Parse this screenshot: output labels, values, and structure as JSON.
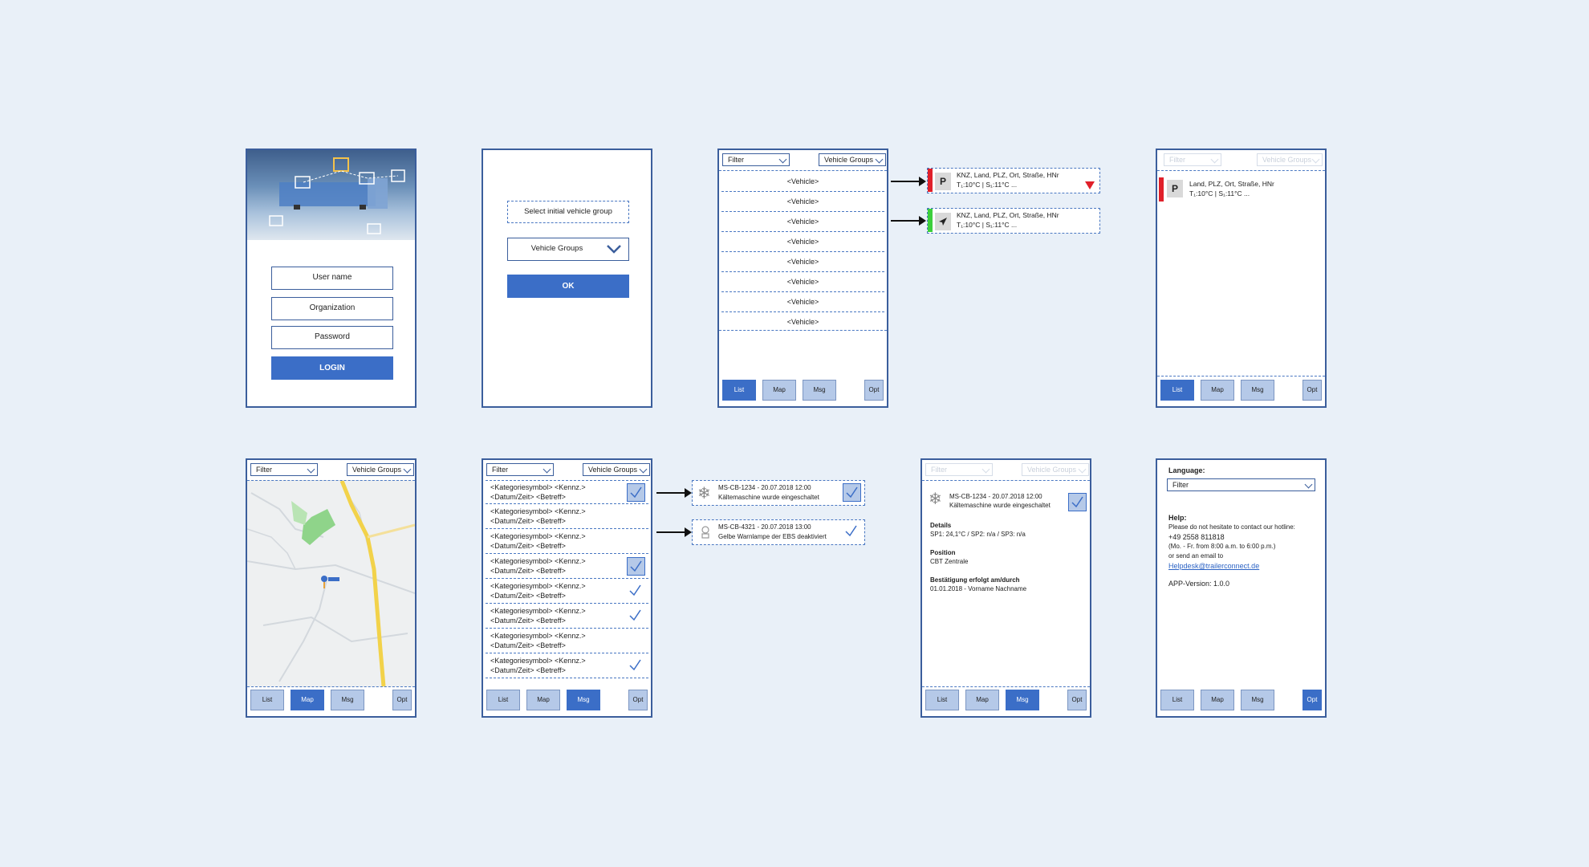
{
  "login": {
    "username_placeholder": "User name",
    "organization_placeholder": "Organization",
    "password_placeholder": "Password",
    "login_label": "LOGIN"
  },
  "group_select": {
    "prompt": "Select initial vehicle group",
    "dropdown_value": "Vehicle Groups",
    "ok_label": "OK"
  },
  "common": {
    "filter": "Filter",
    "vehicle_groups": "Vehicle Groups"
  },
  "nav": {
    "list": "List",
    "map": "Map",
    "msg": "Msg",
    "opt": "Opt"
  },
  "vehicle_list": {
    "items": [
      "<Vehicle>",
      "<Vehicle>",
      "<Vehicle>",
      "<Vehicle>",
      "<Vehicle>",
      "<Vehicle>",
      "<Vehicle>",
      "<Vehicle>"
    ]
  },
  "vehicle_cards": [
    {
      "status_color": "#e0202a",
      "icon": "P",
      "line1": "KNZ, Land, PLZ, Ort, Straße, HNr",
      "line2": "T₁:10°C | S₁:11°C ...",
      "indicator": "alert-triangle-icon"
    },
    {
      "status_color": "#3ccf3c",
      "icon": "navigation-arrow-icon",
      "line1": "KNZ, Land, PLZ, Ort, Straße, HNr",
      "line2": "T₁:10°C | S₁:11°C ..."
    }
  ],
  "vehicle_detail": {
    "icon": "P",
    "line1": "Land, PLZ, Ort, Straße, HNr",
    "line2": "T₁:10°C | S₁:11°C ..."
  },
  "messages": {
    "items": [
      {
        "line1": "<Kategoriesymbol> <Kennz.>",
        "line2": "<Datum/Zeit> <Betreff>",
        "check": "boxed"
      },
      {
        "line1": "<Kategoriesymbol> <Kennz.>",
        "line2": "<Datum/Zeit> <Betreff>",
        "check": "none"
      },
      {
        "line1": "<Kategoriesymbol> <Kennz.>",
        "line2": "<Datum/Zeit> <Betreff>",
        "check": "none"
      },
      {
        "line1": "<Kategoriesymbol> <Kennz.>",
        "line2": "<Datum/Zeit> <Betreff>",
        "check": "boxed"
      },
      {
        "line1": "<Kategoriesymbol> <Kennz.>",
        "line2": "<Datum/Zeit> <Betreff>",
        "check": "plain"
      },
      {
        "line1": "<Kategoriesymbol> <Kennz.>",
        "line2": "<Datum/Zeit> <Betreff>",
        "check": "plain"
      },
      {
        "line1": "<Kategoriesymbol> <Kennz.>",
        "line2": "<Datum/Zeit> <Betreff>",
        "check": "none"
      },
      {
        "line1": "<Kategoriesymbol> <Kennz.>",
        "line2": "<Datum/Zeit> <Betreff>",
        "check": "plain"
      }
    ]
  },
  "message_cards": [
    {
      "icon": "snowflake-icon",
      "line1": "MS-CB-1234 - 20.07.2018 12:00",
      "line2": "Kältemaschine wurde eingeschaltet",
      "check": "boxed"
    },
    {
      "icon": "warning-lamp-icon",
      "line1": "MS-CB-4321 - 20.07.2018 13:00",
      "line2": "Gelbe Warnlampe der EBS deaktiviert",
      "check": "plain"
    }
  ],
  "message_detail": {
    "line1": "MS-CB-1234 - 20.07.2018 12:00",
    "line2": "Kältemaschine wurde eingeschaltet",
    "details_heading": "Details",
    "details_value": "SP1: 24,1°C / SP2: n/a / SP3: n/a",
    "position_heading": "Position",
    "position_value": "CBT Zentrale",
    "confirm_heading": "Bestätigung erfolgt am/durch",
    "confirm_value": "01.01.2018 - Vorname Nachname"
  },
  "options": {
    "language_label": "Language:",
    "language_value": "Filter",
    "help_heading": "Help:",
    "help_line1": "Please do not hesitate to contact our hotline:",
    "phone": "+49 2558 811818",
    "hours": "(Mo. - Fr. from 8:00 a.m. to 6:00 p.m.)",
    "email_prefix": "or send an email to",
    "email": "Helpdesk@trailerconnect.de",
    "version": "APP-Version: 1.0.0"
  },
  "colors": {
    "accent": "#3b6ec7",
    "nav_inactive": "#b5c9e8",
    "frame": "#3b5e9c",
    "background": "#e9f0f8"
  }
}
